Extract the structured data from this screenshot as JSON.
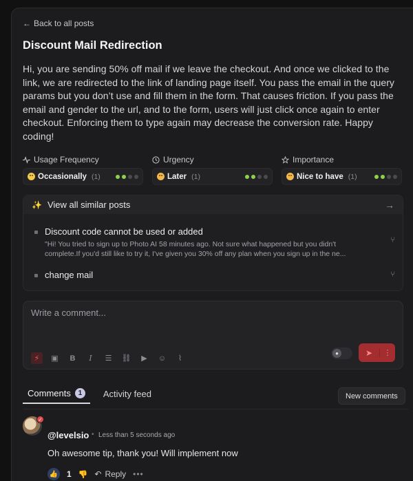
{
  "nav": {
    "back_label": "Back to all posts"
  },
  "post": {
    "title": "Discount Mail Redirection",
    "body": "Hi, you are sending 50% off mail if we leave the checkout. And once we clicked to the link, we are redirected to the link of landing page itself. You pass the email in the query params but you don’t use and fill them in the form. That causes friction. If you pass the email and gender to the url, and to the form, users will just click once again to enter checkout. Enforcing them to type again may decrease the conversion rate. Happy coding!"
  },
  "meta": [
    {
      "label": "Usage Frequency",
      "icon": "pulse-icon",
      "value": "Occasionally",
      "count": "(1)",
      "level": 2,
      "max": 4
    },
    {
      "label": "Urgency",
      "icon": "clock-icon",
      "value": "Later",
      "count": "(1)",
      "level": 2,
      "max": 4
    },
    {
      "label": "Importance",
      "icon": "star-icon",
      "value": "Nice to have",
      "count": "(1)",
      "level": 2,
      "max": 4
    }
  ],
  "similar": {
    "header": "View all similar posts",
    "items": [
      {
        "title": "Discount code cannot be used or added",
        "desc": "\"Hi! You tried to sign up to Photo AI 58 minutes ago. Not sure what happened but you didn't complete.If you'd still like to try it, I've given you 30% off any plan when you sign up in the ne..."
      },
      {
        "title": "change mail",
        "desc": ""
      }
    ]
  },
  "composer": {
    "placeholder": "Write a comment..."
  },
  "tabs": {
    "comments_label": "Comments",
    "comments_count": "1",
    "activity_label": "Activity feed",
    "new_comments_label": "New comments"
  },
  "comment": {
    "user": "@levelsio",
    "time": "Less than 5 seconds ago",
    "text": "Oh awesome tip, thank you! Will implement now",
    "likes": "1",
    "reply_label": "Reply"
  },
  "colors": {
    "accent": "#a42d30",
    "level_on": "#8fd14f",
    "badge": "#c7c7e6"
  }
}
